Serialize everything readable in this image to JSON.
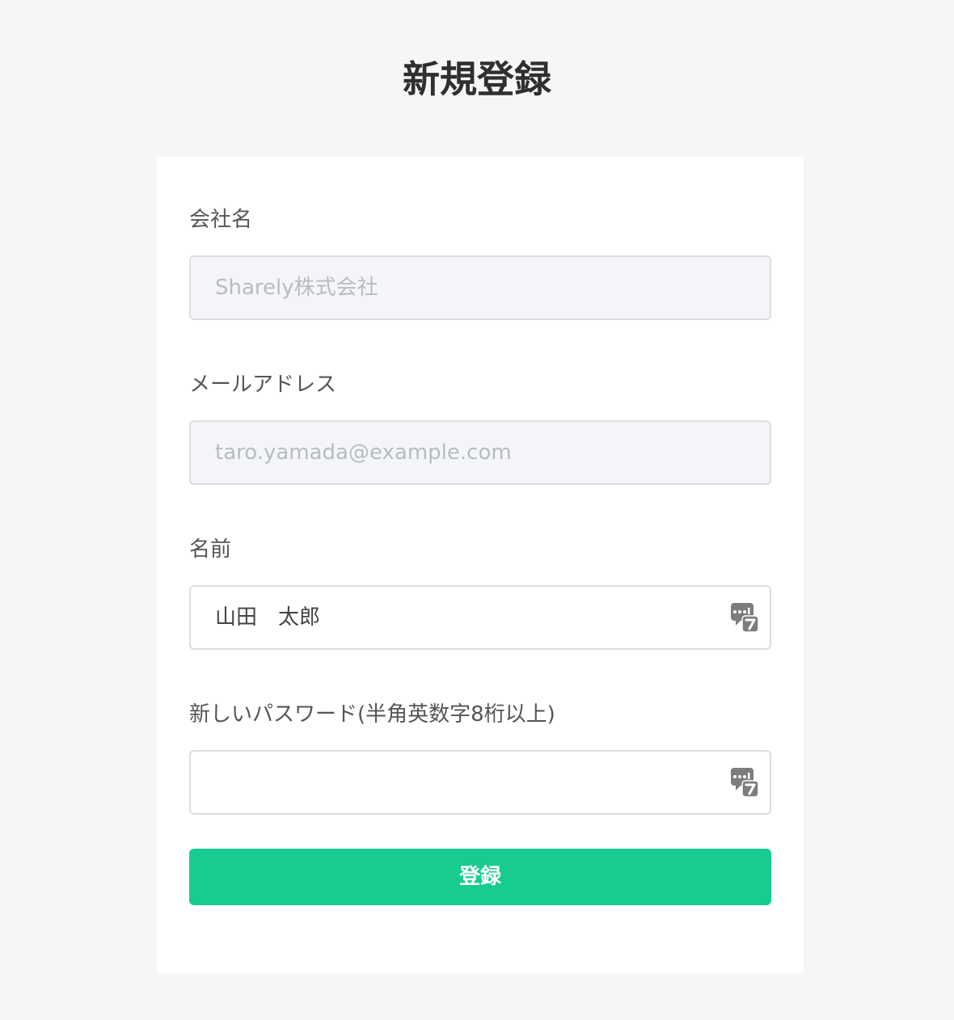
{
  "page": {
    "title": "新規登録"
  },
  "form": {
    "company": {
      "label": "会社名",
      "value": "Sharely株式会社",
      "disabled": true
    },
    "email": {
      "label": "メールアドレス",
      "value": "taro.yamada@example.com",
      "disabled": true
    },
    "name": {
      "label": "名前",
      "value": "山田　太郎"
    },
    "password": {
      "label": "新しいパスワード(半角英数字8桁以上)",
      "value": ""
    },
    "submit_label": "登録"
  },
  "icons": {
    "autofill": "password-autofill-icon"
  },
  "colors": {
    "background": "#f5f6f8",
    "card": "#ffffff",
    "accent": "#17cb91",
    "disabled_input": "#f4f5f8"
  }
}
